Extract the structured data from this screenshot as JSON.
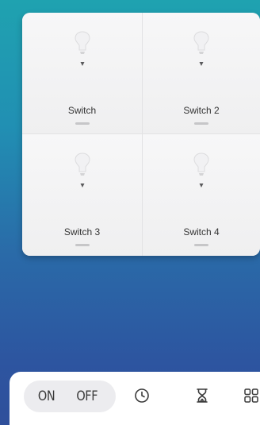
{
  "switches": [
    {
      "label": "Switch",
      "icon": "lightbulb-icon"
    },
    {
      "label": "Switch 2",
      "icon": "lightbulb-icon"
    },
    {
      "label": "Switch 3",
      "icon": "lightbulb-icon"
    },
    {
      "label": "Switch 4",
      "icon": "lightbulb-icon"
    }
  ],
  "toolbar": {
    "on_label": "ON",
    "off_label": "OFF",
    "icons": [
      "clock-icon",
      "hourglass-icon",
      "grid-icon"
    ]
  },
  "colors": {
    "background_top": "#1fa2b0",
    "background_bottom": "#2f4f9b",
    "panel": "#f4f4f5",
    "icon_gray": "#b9b9bb",
    "text": "#333333"
  }
}
